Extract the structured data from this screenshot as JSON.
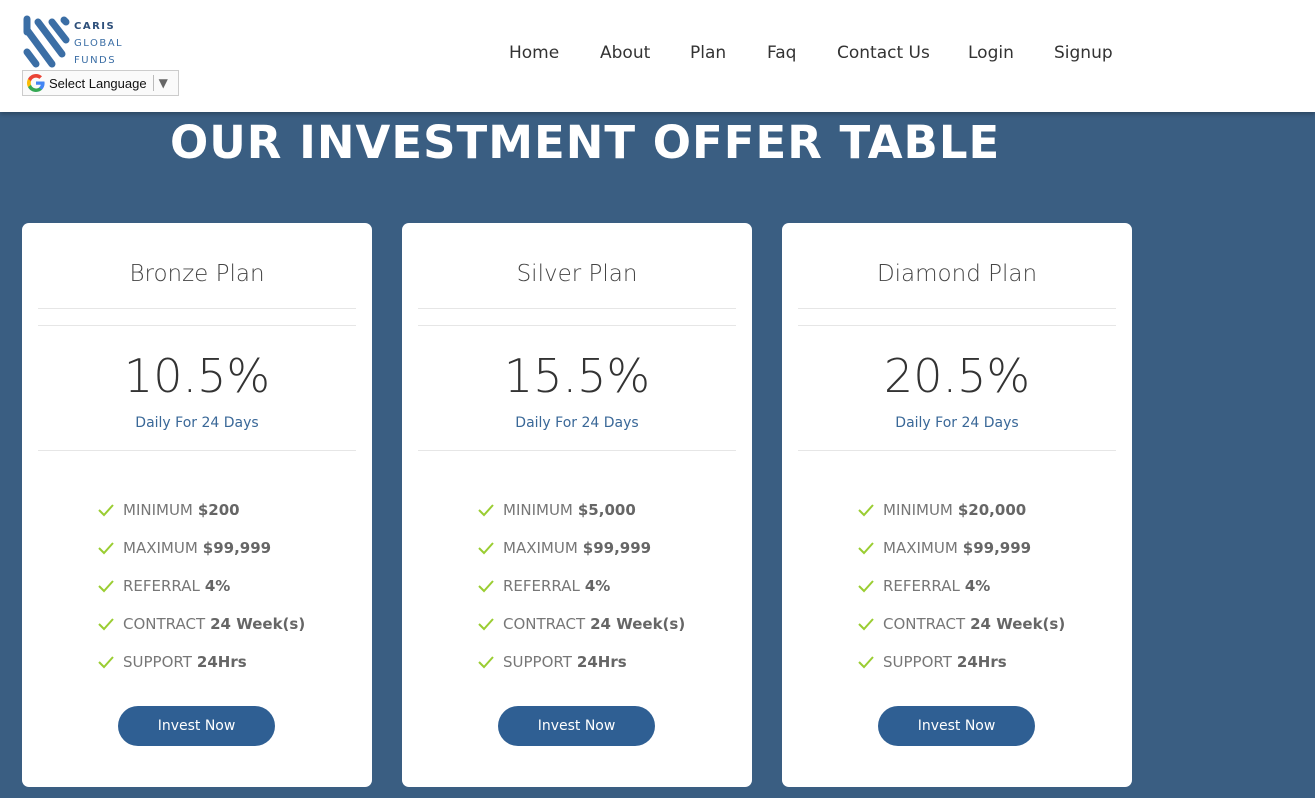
{
  "brand": {
    "logo_line1": "CARIS",
    "logo_line2": "GLOBAL",
    "logo_line3": "FUNDS",
    "accent_color": "#3b6ea5",
    "background_color": "#3a5e82",
    "button_color": "#2f5f93",
    "check_color": "#9acd32"
  },
  "language_selector": {
    "label": "Select Language",
    "arrow": "▼",
    "icon": "google-g-icon"
  },
  "nav": {
    "items": [
      {
        "label": "Home"
      },
      {
        "label": "About"
      },
      {
        "label": "Plan"
      },
      {
        "label": "Faq"
      },
      {
        "label": "Contact Us"
      },
      {
        "label": "Login"
      },
      {
        "label": "Signup"
      }
    ]
  },
  "page": {
    "title": "OUR INVESTMENT OFFER TABLE"
  },
  "plans": [
    {
      "name": "Bronze Plan",
      "rate": "10.5%",
      "period": "Daily For 24 Days",
      "features": [
        {
          "label": "MINIMUM",
          "value": "$200"
        },
        {
          "label": "MAXIMUM",
          "value": "$99,999"
        },
        {
          "label": "REFERRAL",
          "value": "4%"
        },
        {
          "label": "CONTRACT",
          "value": "24 Week(s)"
        },
        {
          "label": "SUPPORT",
          "value": "24Hrs"
        }
      ],
      "button_label": "Invest Now"
    },
    {
      "name": "Silver Plan",
      "rate": "15.5%",
      "period": "Daily For 24 Days",
      "features": [
        {
          "label": "MINIMUM",
          "value": "$5,000"
        },
        {
          "label": "MAXIMUM",
          "value": "$99,999"
        },
        {
          "label": "REFERRAL",
          "value": "4%"
        },
        {
          "label": "CONTRACT",
          "value": "24 Week(s)"
        },
        {
          "label": "SUPPORT",
          "value": "24Hrs"
        }
      ],
      "button_label": "Invest Now"
    },
    {
      "name": "Diamond Plan",
      "rate": "20.5%",
      "period": "Daily For 24 Days",
      "features": [
        {
          "label": "MINIMUM",
          "value": "$20,000"
        },
        {
          "label": "MAXIMUM",
          "value": "$99,999"
        },
        {
          "label": "REFERRAL",
          "value": "4%"
        },
        {
          "label": "CONTRACT",
          "value": "24 Week(s)"
        },
        {
          "label": "SUPPORT",
          "value": "24Hrs"
        }
      ],
      "button_label": "Invest Now"
    }
  ]
}
